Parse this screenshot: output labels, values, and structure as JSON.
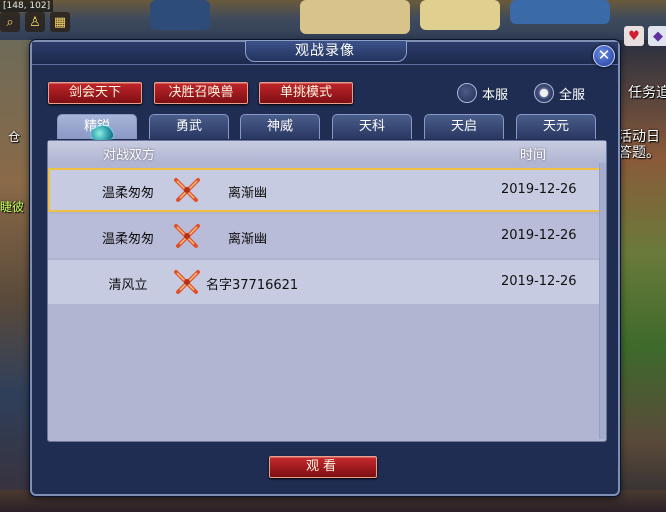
{
  "hud": {
    "coords": "[148, 102]"
  },
  "side": {
    "task_label": "任务追",
    "event_text": "活动日",
    "event_text2": "答题。",
    "left_text": "仓",
    "left_text2": "睫彼"
  },
  "dialog": {
    "title": "观战录像",
    "close_label": "✕",
    "category_buttons": [
      "剑会天下",
      "决胜召唤兽",
      "单挑模式"
    ],
    "server_options": [
      {
        "label": "本服",
        "selected": false
      },
      {
        "label": "全服",
        "selected": true
      }
    ],
    "tabs": [
      "精锐",
      "勇武",
      "神威",
      "天科",
      "天启",
      "天元"
    ],
    "active_tab": 0,
    "table": {
      "col_players": "对战双方",
      "col_time": "时间",
      "rows": [
        {
          "player1": "温柔匆匆",
          "player2": "离渐幽",
          "date": "2019-12-26"
        },
        {
          "player1": "温柔匆匆",
          "player2": "离渐幽",
          "date": "2019-12-26"
        },
        {
          "player1": "清风立",
          "player2": "名字37716621",
          "date": "2019-12-26"
        }
      ],
      "selected_row": 0
    },
    "watch_button": "观看"
  },
  "colors": {
    "accent_red": "#c0262a",
    "panel_bg": "#1f2d52",
    "list_bg": "#b0b5d2",
    "selection": "#f0c040"
  }
}
